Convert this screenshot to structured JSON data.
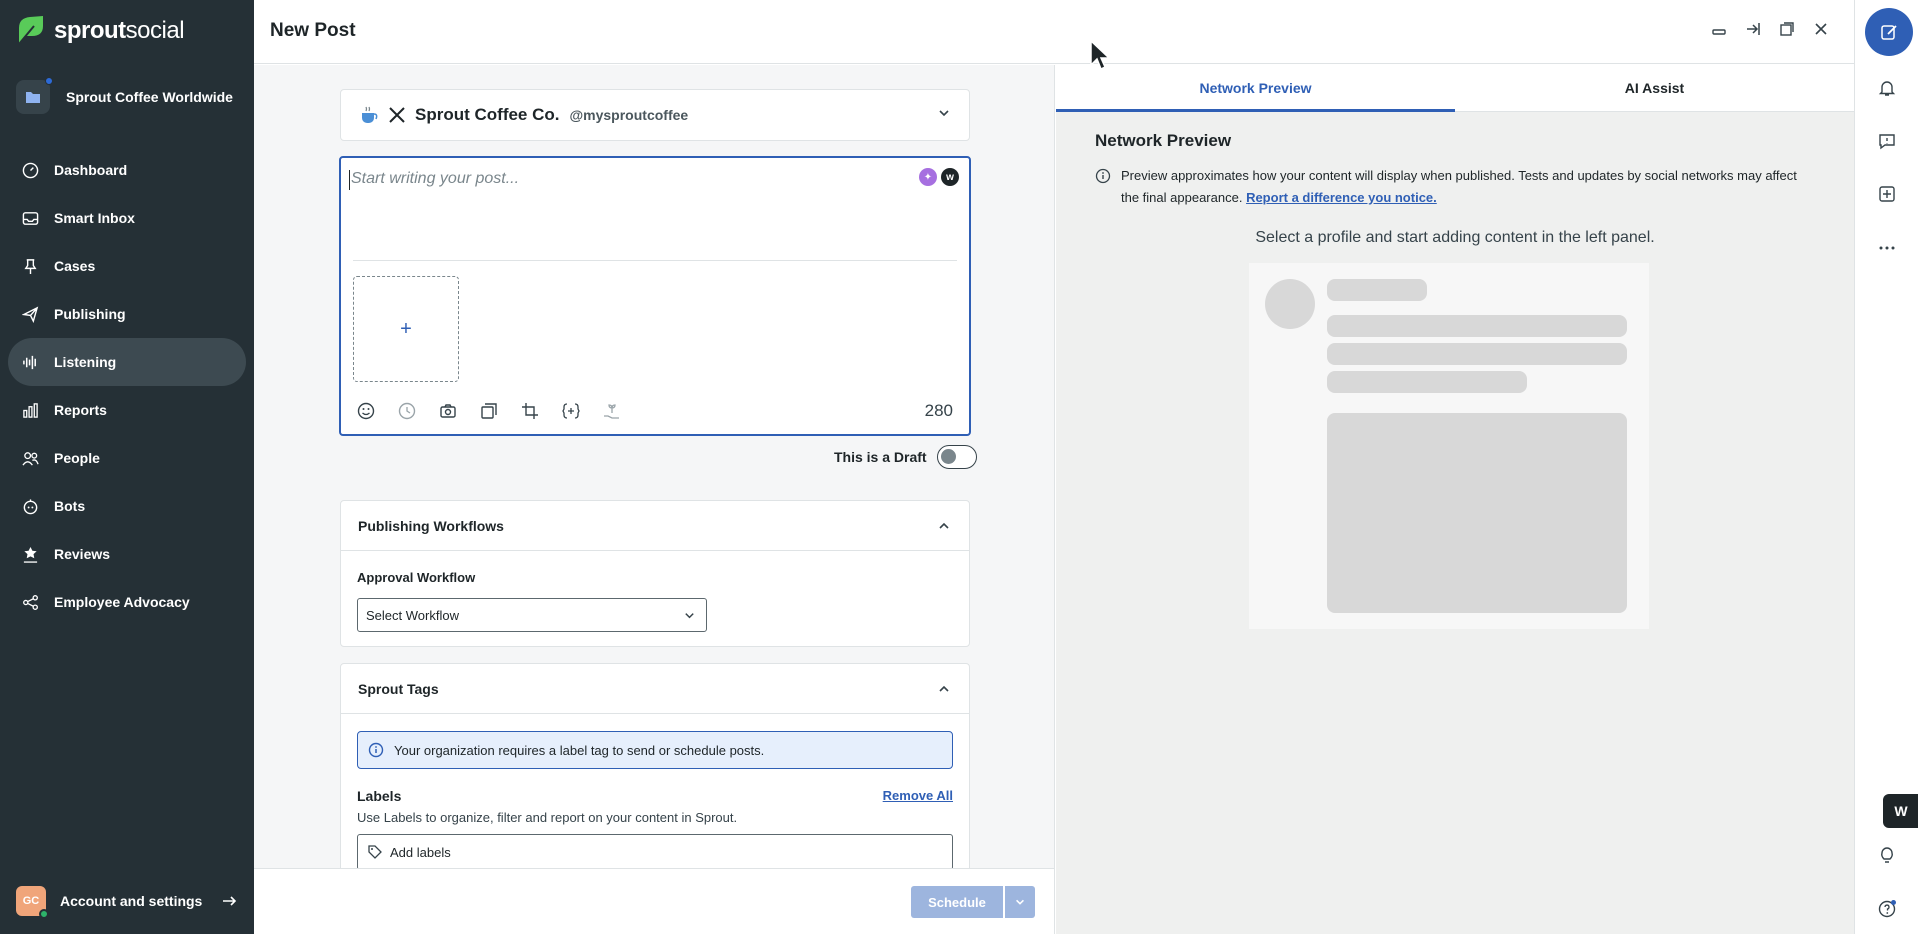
{
  "app": {
    "brand_bold": "sprout",
    "brand_light": "social",
    "workspace": "Sprout Coffee Worldwide",
    "account": "Account and settings",
    "avatar_initials": "GC"
  },
  "nav": [
    {
      "label": "Dashboard",
      "icon": "dashboard-icon"
    },
    {
      "label": "Smart Inbox",
      "icon": "inbox-icon"
    },
    {
      "label": "Cases",
      "icon": "pin-icon"
    },
    {
      "label": "Publishing",
      "icon": "paper-plane-icon"
    },
    {
      "label": "Listening",
      "icon": "waveform-icon",
      "active": true
    },
    {
      "label": "Reports",
      "icon": "bar-chart-icon"
    },
    {
      "label": "People",
      "icon": "people-icon"
    },
    {
      "label": "Bots",
      "icon": "bot-icon"
    },
    {
      "label": "Reviews",
      "icon": "star-hand-icon"
    },
    {
      "label": "Employee Advocacy",
      "icon": "share-nodes-icon"
    }
  ],
  "header": {
    "title": "New Post"
  },
  "compose": {
    "profile_name": "Sprout Coffee Co.",
    "profile_handle": "@mysproutcoffee",
    "placeholder": "Start writing your post...",
    "char_count": "280",
    "draft_label": "This is a Draft",
    "workflows_title": "Publishing Workflows",
    "approval_label": "Approval Workflow",
    "workflow_select": "Select Workflow",
    "tags_title": "Sprout Tags",
    "tags_banner": "Your organization requires a label tag to send or schedule posts.",
    "labels_title": "Labels",
    "remove_all": "Remove All",
    "labels_help": "Use Labels to organize, filter and report on your content in Sprout.",
    "labels_placeholder": "Add labels",
    "schedule": "Schedule"
  },
  "preview": {
    "tabs": [
      "Network Preview",
      "AI Assist"
    ],
    "title": "Network Preview",
    "note": "Preview approximates how your content will display when published. Tests and updates by social networks may affect the final appearance.",
    "note_link": "Report a difference you notice.",
    "instruction": "Select a profile and start adding content in the left panel."
  },
  "colors": {
    "sidebar": "#253036",
    "accent": "#2f5fb5",
    "active_nav": "#3d4a51"
  }
}
